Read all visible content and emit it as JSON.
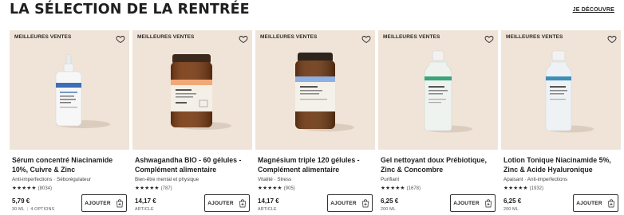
{
  "section": {
    "title": "LA SÉLECTION DE LA RENTRÉE",
    "link": "JE DÉCOUVRE"
  },
  "icons": {
    "favorite": "heart-outline-icon",
    "cart": "shopping-bag-plus-icon",
    "star": "★"
  },
  "colors": {
    "media_bg": "#f0e4d8",
    "text": "#222222",
    "accent_blue": "#3d6fb8",
    "accent_green": "#3aa57a",
    "amber": "#7a3a12"
  },
  "products": [
    {
      "badge": "MEILLEURES VENTES",
      "name": "Sérum concentré Niacinamide 10%, Cuivre & Zinc",
      "tags": "Anti-imperfections · Séborégulateur",
      "stars": "★★★★★",
      "reviews": "(8034)",
      "price": "5,79 €",
      "unit": "30 ML",
      "options": "4 OPTIONS",
      "cta": "AJOUTER"
    },
    {
      "badge": "MEILLEURES VENTES",
      "name": "Ashwagandha BIO - 60 gélules - Complément alimentaire",
      "tags": "Bien-être mental et physique",
      "stars": "★★★★★",
      "reviews": "(787)",
      "price": "14,17 €",
      "unit": "ARTICLE",
      "options": "",
      "cta": "AJOUTER"
    },
    {
      "badge": "MEILLEURES VENTES",
      "name": "Magnésium triple 120 gélules - Complément alimentaire",
      "tags": "Vitalité · Stress",
      "stars": "★★★★★",
      "reviews": "(905)",
      "price": "14,17 €",
      "unit": "ARTICLE",
      "options": "",
      "cta": "AJOUTER"
    },
    {
      "badge": "MEILLEURES VENTES",
      "name": "Gel nettoyant doux Prébiotique, Zinc & Concombre",
      "tags": "Purifiant",
      "stars": "★★★★★",
      "reviews": "(1678)",
      "price": "6,25 €",
      "unit": "200 ML",
      "options": "",
      "cta": "AJOUTER"
    },
    {
      "badge": "MEILLEURES VENTES",
      "name": "Lotion Tonique Niacinamide 5%, Zinc & Acide Hyaluronique",
      "tags": "Apaisant · Anti-imperfections",
      "stars": "★★★★★",
      "reviews": "(1932)",
      "price": "6,25 €",
      "unit": "200 ML",
      "options": "",
      "cta": "AJOUTER"
    }
  ]
}
